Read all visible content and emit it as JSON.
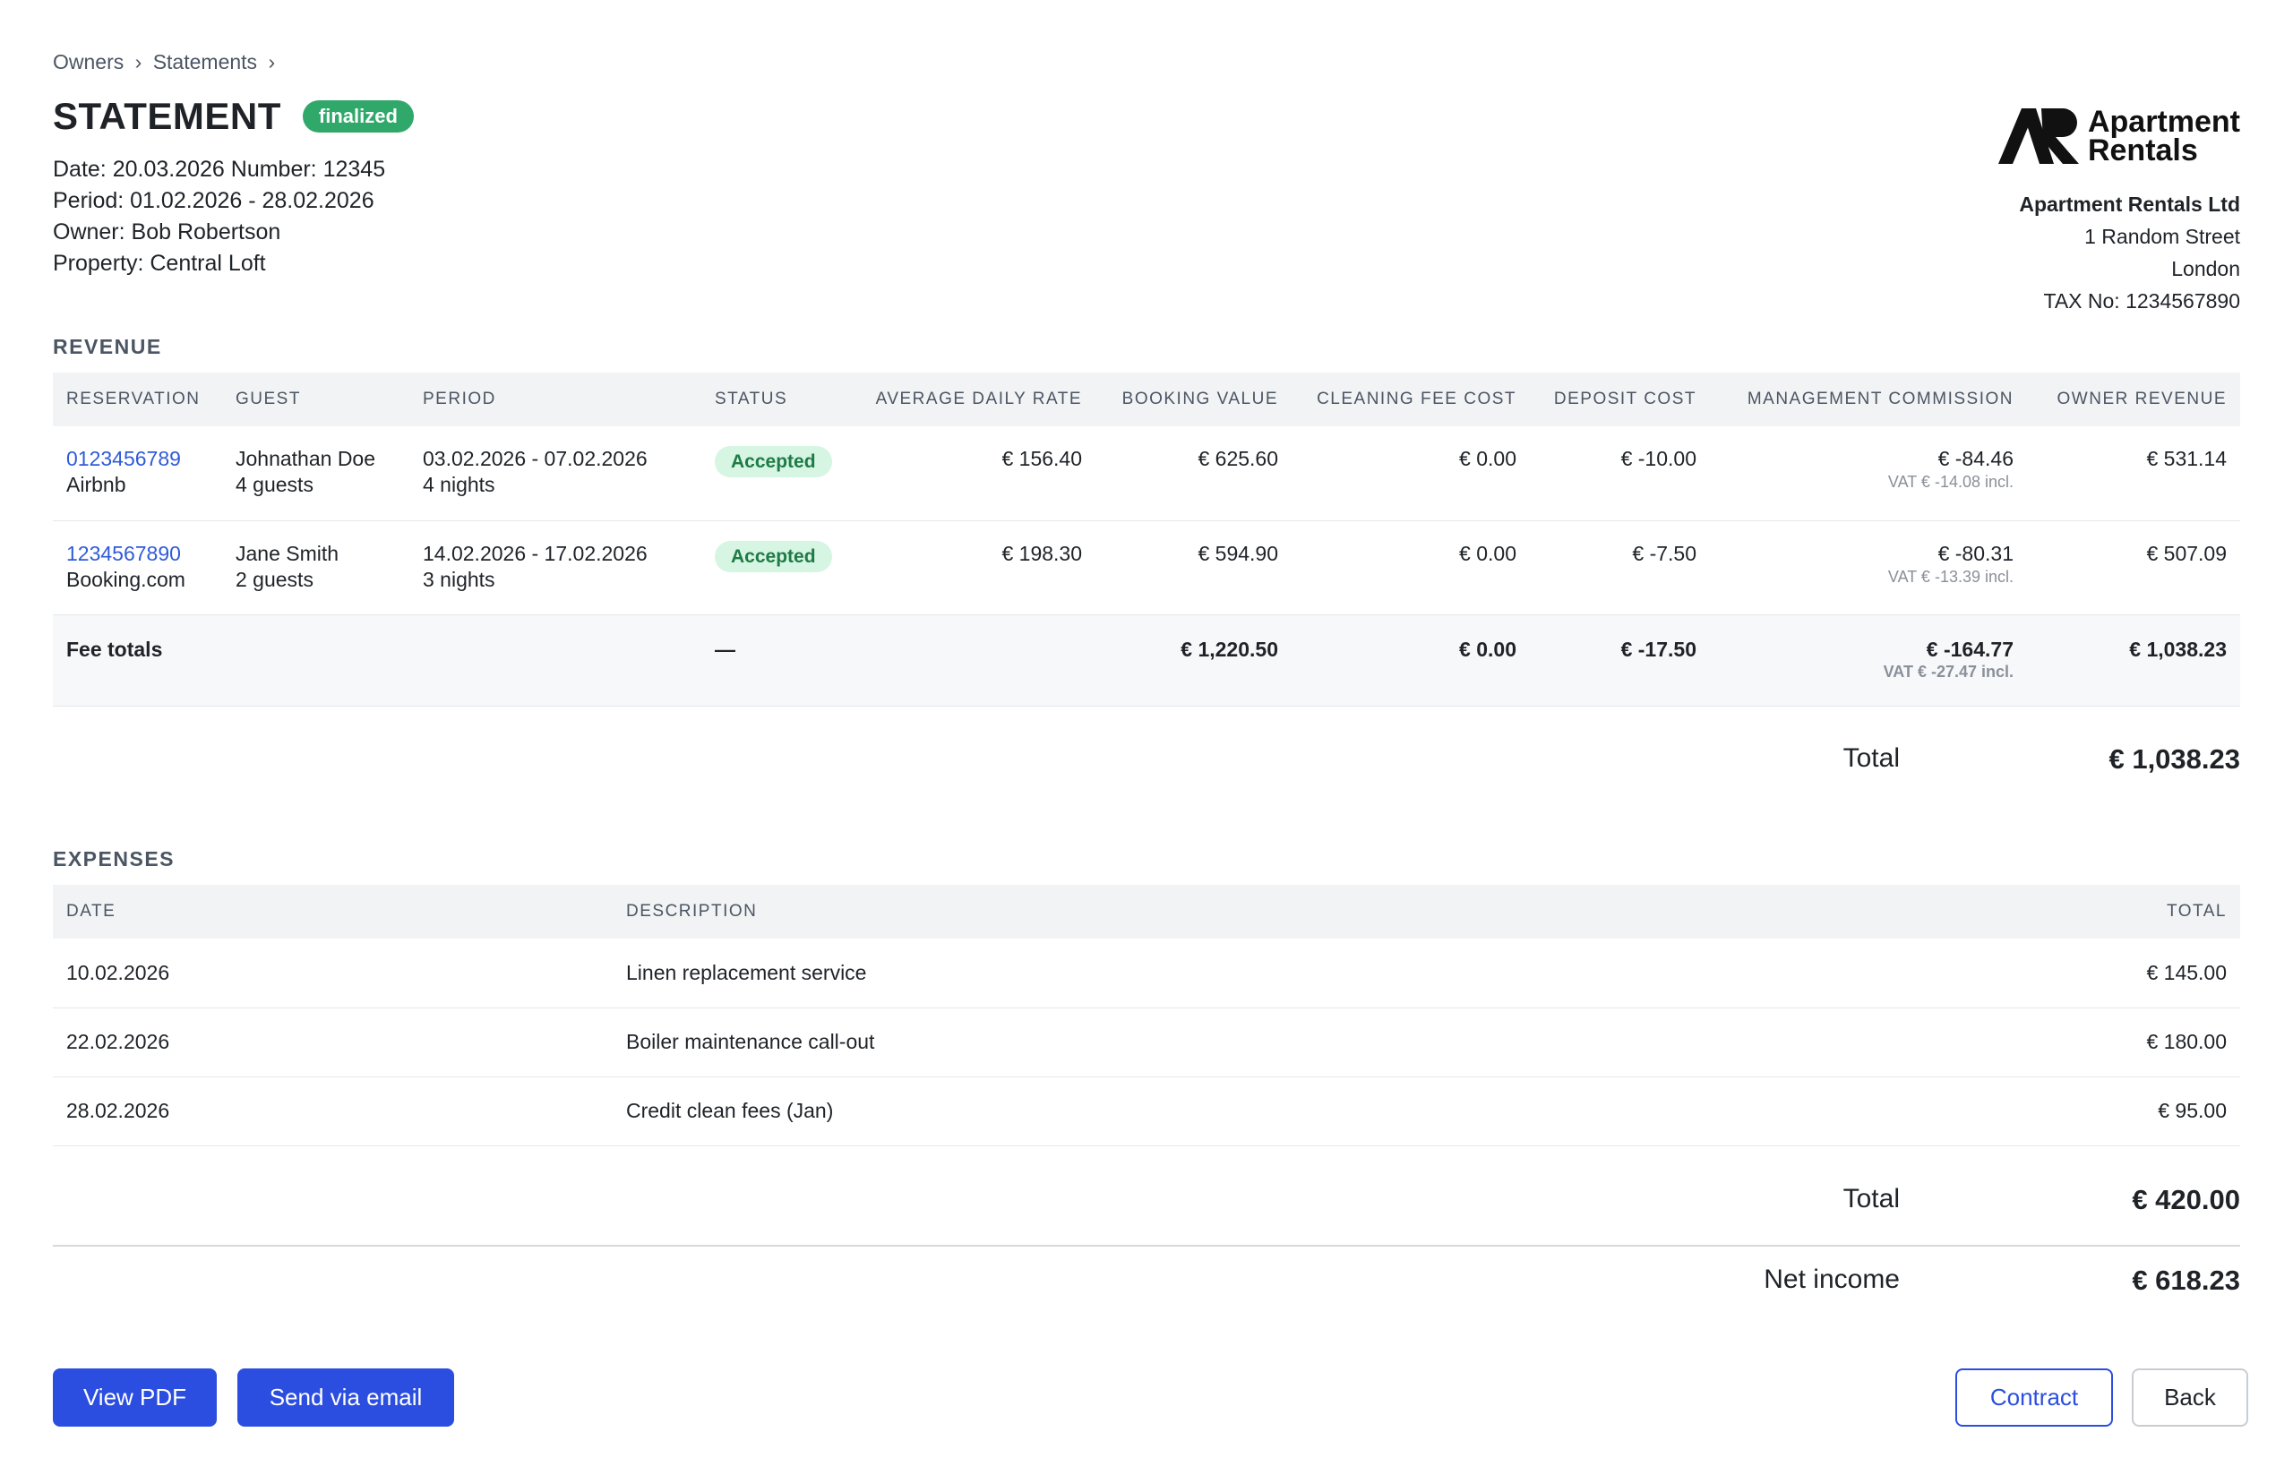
{
  "breadcrumb": {
    "items": [
      "Owners",
      "Statements"
    ],
    "separator": "›"
  },
  "header": {
    "title": "STATEMENT",
    "badge": "finalized",
    "date_line": "Date: 20.03.2026 Number: 12345",
    "period_line": "Period: 01.02.2026 - 28.02.2026",
    "owner_line": "Owner: Bob Robertson",
    "property_line": "Property: Central Loft"
  },
  "company": {
    "logo_line1": "Apartment",
    "logo_line2": "Rentals",
    "name": "Apartment Rentals Ltd",
    "street": "1 Random Street",
    "city": "London",
    "tax": "TAX No: 1234567890"
  },
  "revenue": {
    "section_title": "REVENUE",
    "columns": [
      "Reservation",
      "Guest",
      "Period",
      "Status",
      "Average daily rate",
      "Booking value",
      "Cleaning fee cost",
      "Deposit cost",
      "Management commission",
      "Owner revenue"
    ],
    "rows": [
      {
        "reservation": "0123456789",
        "channel": "Airbnb",
        "guest": "Johnathan Doe",
        "guests": "4 guests",
        "period": "03.02.2026 - 07.02.2026",
        "nights": "4 nights",
        "status": "Accepted",
        "adr": "€ 156.40",
        "booking_value": "€ 625.60",
        "cleaning": "€ 0.00",
        "deposit": "€ -10.00",
        "commission": "€ -84.46",
        "vat": "VAT € -14.08 incl.",
        "owner_revenue": "€ 531.14"
      },
      {
        "reservation": "1234567890",
        "channel": "Booking.com",
        "guest": "Jane Smith",
        "guests": "2 guests",
        "period": "14.02.2026 - 17.02.2026",
        "nights": "3 nights",
        "status": "Accepted",
        "adr": "€ 198.30",
        "booking_value": "€ 594.90",
        "cleaning": "€ 0.00",
        "deposit": "€ -7.50",
        "commission": "€ -80.31",
        "vat": "VAT € -13.39 incl.",
        "owner_revenue": "€ 507.09"
      }
    ],
    "totals": {
      "label": "Fee totals",
      "status": "—",
      "booking_value": "€ 1,220.50",
      "cleaning": "€ 0.00",
      "deposit": "€ -17.50",
      "commission": "€ -164.77",
      "vat": "VAT € -27.47 incl.",
      "owner_revenue": "€ 1,038.23"
    },
    "total_label": "Total",
    "total_value": "€ 1,038.23"
  },
  "expenses": {
    "section_title": "EXPENSES",
    "columns": [
      "Date",
      "Description",
      "Total"
    ],
    "rows": [
      {
        "date": "10.02.2026",
        "description": "Linen replacement service",
        "total": "€ 145.00"
      },
      {
        "date": "22.02.2026",
        "description": "Boiler maintenance call-out",
        "total": "€ 180.00"
      },
      {
        "date": "28.02.2026",
        "description": "Credit clean fees (Jan)",
        "total": "€ 95.00"
      }
    ],
    "total_label": "Total",
    "total_value": "€ 420.00"
  },
  "net": {
    "label": "Net income",
    "value": "€ 618.23"
  },
  "actions": {
    "view_pdf": "View PDF",
    "send_email": "Send via email",
    "contract": "Contract",
    "back": "Back"
  },
  "colors": {
    "accent": "#2b4ee0",
    "success": "#2fa86a",
    "link": "#2f5bd8"
  }
}
